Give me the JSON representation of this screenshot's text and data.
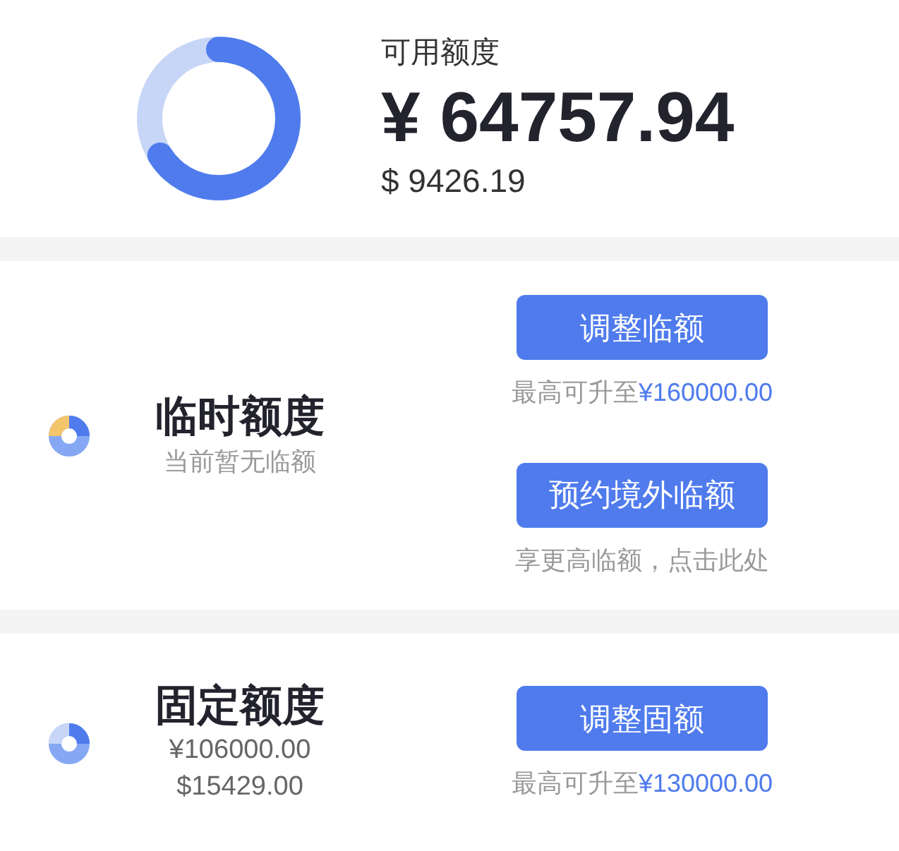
{
  "available": {
    "label": "可用额度",
    "amount_cny": "¥ 64757.94",
    "amount_usd": "$ 9426.19"
  },
  "sections": [
    {
      "kind": "temporary",
      "title": "临时额度",
      "lines": [
        "当前暂无临额"
      ],
      "actions": [
        {
          "button": "调整临额",
          "hint": "最高可升至",
          "hint_amount": "¥160000.00"
        },
        {
          "button": "预约境外临额",
          "hint": "享更高临额，点击此处"
        }
      ]
    },
    {
      "kind": "fixed",
      "title": "固定额度",
      "lines": [
        "¥106000.00",
        "$15429.00"
      ],
      "actions": [
        {
          "button": "调整固额",
          "hint": "最高可升至",
          "hint_amount": "¥130000.00"
        }
      ]
    }
  ]
}
